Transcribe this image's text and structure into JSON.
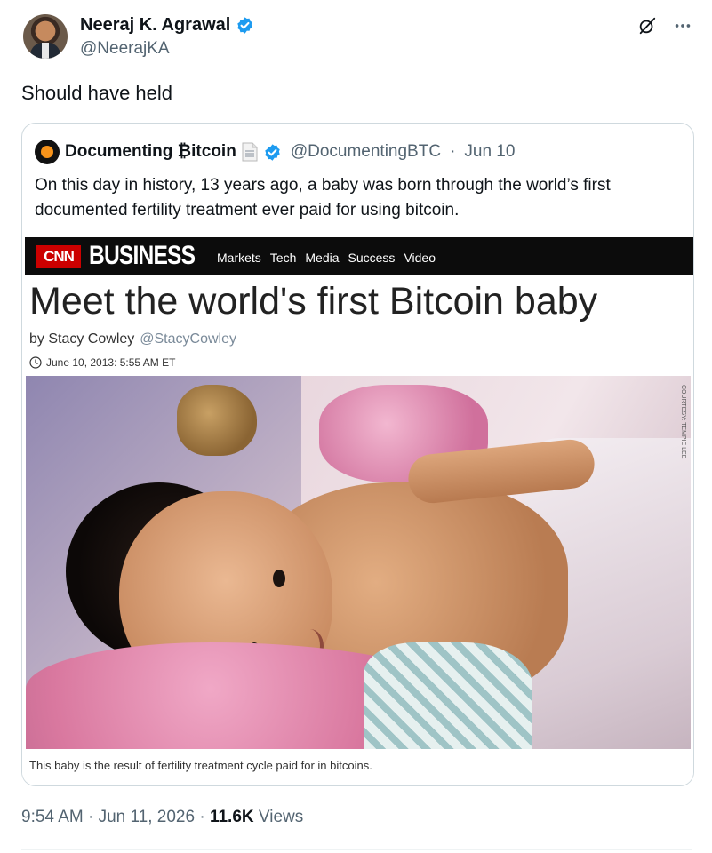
{
  "colors": {
    "verified_blue": "#1d9bf0",
    "text_primary": "#0f1419",
    "text_secondary": "#536471",
    "cnn_red": "#cc0000",
    "bitcoin_orange": "#f7931a"
  },
  "author": {
    "name": "Neeraj K. Agrawal",
    "handle": "@NeerajKA",
    "avatar_icon": "profile-photo",
    "verified_icon": "verified-badge-icon"
  },
  "top_icons": [
    "grok-icon",
    "more-icon"
  ],
  "tweet": {
    "text": "Should have held"
  },
  "quoted": {
    "name": "Documenting ₿itcoin",
    "handle": "@DocumentingBTC",
    "separator": "·",
    "date": "Jun 10",
    "text": "On this day in history, 13 years ago, a baby was born through the world’s first documented fertility treatment ever paid for using bitcoin.",
    "article": {
      "logo": "CNN",
      "section": "BUSINESS",
      "nav": [
        "Markets",
        "Tech",
        "Media",
        "Success",
        "Video"
      ],
      "headline": "Meet the world's first Bitcoin baby",
      "byline": "by Stacy Cowley",
      "byline_twitter": "@StacyCowley",
      "date": "June 10, 2013: 5:55 AM ET",
      "photo_credit": "COURTESY: TEMPIE LEE",
      "caption": "This baby is the result of fertility treatment cycle paid for in bitcoins."
    }
  },
  "meta": {
    "time": "9:54 AM",
    "date": "Jun 11, 2026",
    "sep": "·",
    "views_count": "11.6K",
    "views_label": "Views"
  }
}
